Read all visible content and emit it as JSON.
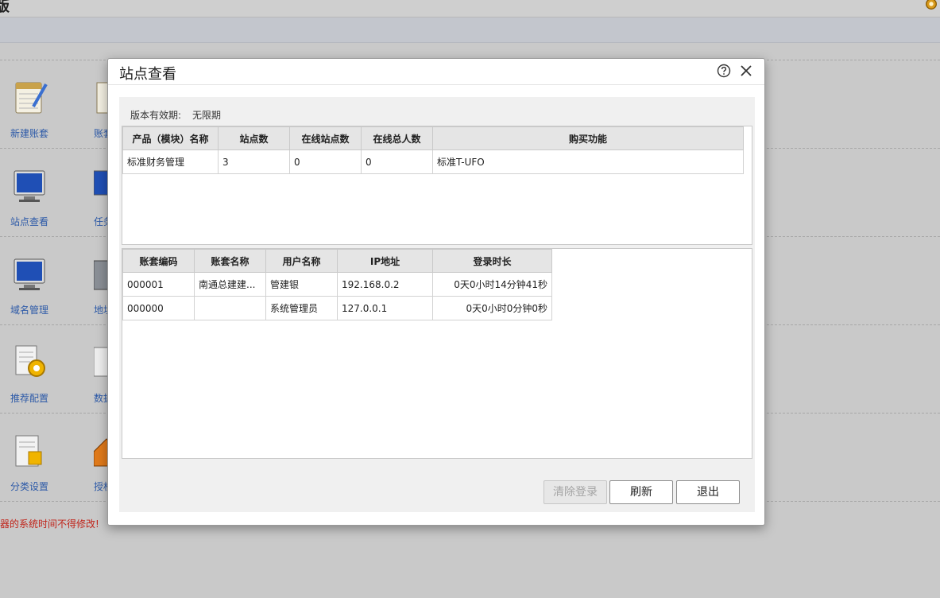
{
  "background": {
    "app_title_fragment": "版",
    "tiles": [
      {
        "label": "新建账套",
        "icon": "ledger-notebook-icon"
      },
      {
        "label": "站点查看",
        "icon": "monitor-icon"
      },
      {
        "label": "域名管理",
        "icon": "monitor-icon"
      },
      {
        "label": "推荐配置",
        "icon": "document-gear-icon"
      },
      {
        "label": "分类设置",
        "icon": "document-settings-icon"
      }
    ],
    "tiles_col2": [
      {
        "label": "账套",
        "icon": "notebook-icon"
      },
      {
        "label": "任务",
        "icon": "monitor-icon"
      },
      {
        "label": "地址",
        "icon": "server-icon"
      },
      {
        "label": "数据",
        "icon": "document-icon"
      },
      {
        "label": "授权",
        "icon": "house-icon"
      }
    ],
    "warning": "器的系统时间不得修改!"
  },
  "dialog": {
    "title": "站点查看",
    "validity_label": "版本有效期:",
    "validity_value": "无限期",
    "products_table": {
      "headers": [
        "产品（模块）名称",
        "站点数",
        "在线站点数",
        "在线总人数",
        "购买功能"
      ],
      "rows": [
        [
          "标准财务管理",
          "3",
          "0",
          "0",
          "标准T-UFO"
        ]
      ]
    },
    "sessions_table": {
      "headers": [
        "账套编码",
        "账套名称",
        "用户名称",
        "IP地址",
        "登录时长"
      ],
      "rows": [
        [
          "000001",
          "南通总建建...",
          "管建银",
          "192.168.0.2",
          "0天0小时14分钟41秒"
        ],
        [
          "000000",
          "",
          "系统管理员",
          "127.0.0.1",
          "0天0小时0分钟0秒"
        ]
      ]
    },
    "buttons": {
      "clear_login": "清除登录",
      "refresh": "刷新",
      "exit": "退出"
    }
  }
}
